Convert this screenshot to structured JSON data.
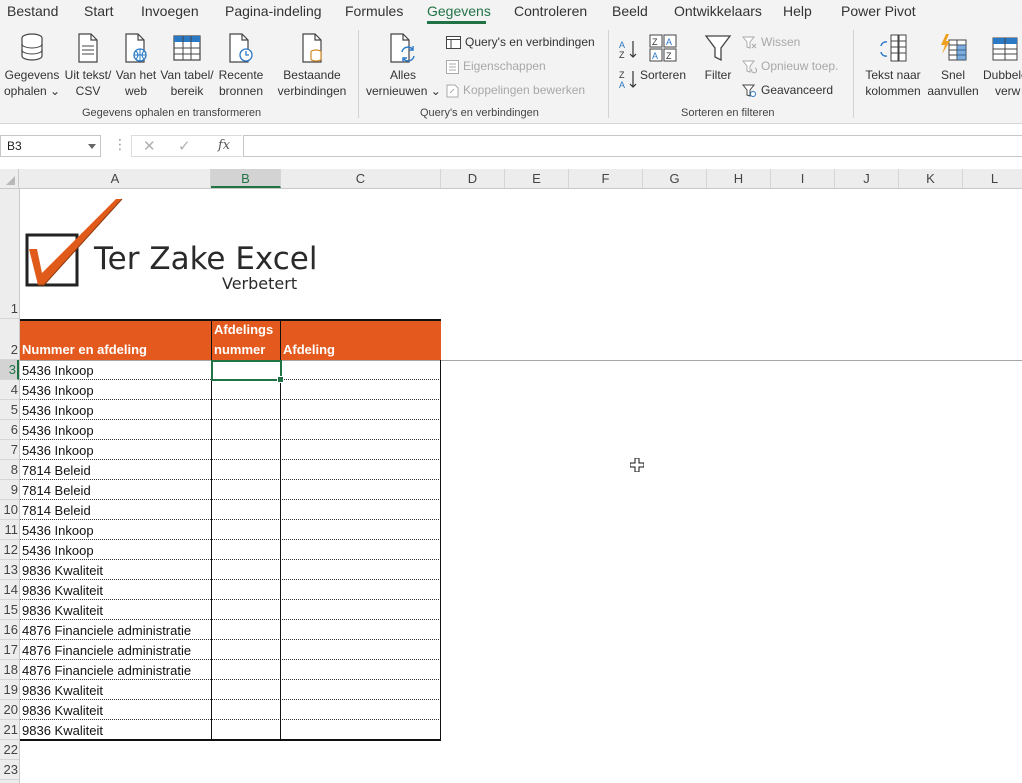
{
  "ribbon_tabs": [
    "Bestand",
    "Start",
    "Invoegen",
    "Pagina-indeling",
    "Formules",
    "Gegevens",
    "Controleren",
    "Beeld",
    "Ontwikkelaars",
    "Help",
    "Power Pivot"
  ],
  "active_tab": "Gegevens",
  "ribbon": {
    "get_data": {
      "line1": "Gegevens",
      "line2": "ophalen ⌄"
    },
    "from_text": {
      "line1": "Uit tekst/",
      "line2": "CSV"
    },
    "from_web": {
      "line1": "Van het",
      "line2": "web"
    },
    "from_table": {
      "line1": "Van tabel/",
      "line2": "bereik"
    },
    "recent_sources": {
      "line1": "Recente",
      "line2": "bronnen"
    },
    "existing_connections": {
      "line1": "Bestaande",
      "line2": "verbindingen"
    },
    "group_get_transform": "Gegevens ophalen en transformeren",
    "refresh_all": {
      "line1": "Alles",
      "line2": "vernieuwen ⌄"
    },
    "queries_connections": "Query's en verbindingen",
    "properties": "Eigenschappen",
    "edit_links": "Koppelingen bewerken",
    "group_queries": "Query's en verbindingen",
    "sort": "Sorteren",
    "filter": "Filter",
    "clear": "Wissen",
    "reapply": "Opnieuw toep.",
    "advanced": "Geavanceerd",
    "group_sort_filter": "Sorteren en filteren",
    "text_to_columns": {
      "line1": "Tekst naar",
      "line2": "kolommen"
    },
    "flash_fill": {
      "line1": "Snel",
      "line2": "aanvullen"
    },
    "remove_duplicates": {
      "line1": "Dubbele",
      "line2": "verw"
    }
  },
  "formula_bar": {
    "name_box": "B3",
    "cancel": "✕",
    "enter": "✓",
    "fx": "fx",
    "formula": ""
  },
  "columns": [
    "A",
    "B",
    "C",
    "D",
    "E",
    "F",
    "G",
    "H",
    "I",
    "J",
    "K",
    "L"
  ],
  "selected_column": "B",
  "rows": [
    "1",
    "2",
    "3",
    "4",
    "5",
    "6",
    "7",
    "8",
    "9",
    "10",
    "11",
    "12",
    "13",
    "14",
    "15",
    "16",
    "17",
    "18",
    "19",
    "20",
    "21",
    "22",
    "23"
  ],
  "selected_row": "3",
  "logo": {
    "title": "Ter Zake Excel",
    "subtitle": "Verbetert"
  },
  "table": {
    "headers": {
      "a": "Nummer en afdeling",
      "b_line1": "Afdelings",
      "b_line2": "nummer",
      "c": "Afdeling"
    },
    "values": [
      "5436 Inkoop",
      "5436 Inkoop",
      "5436 Inkoop",
      "5436 Inkoop",
      "5436 Inkoop",
      "7814 Beleid",
      "7814 Beleid",
      "7814 Beleid",
      "5436 Inkoop",
      "5436 Inkoop",
      "9836 Kwaliteit",
      "9836 Kwaliteit",
      "9836 Kwaliteit",
      "4876 Financiele administratie",
      "4876 Financiele administratie",
      "4876 Financiele administratie",
      "9836 Kwaliteit",
      "9836 Kwaliteit",
      "9836 Kwaliteit"
    ]
  },
  "colors": {
    "accent": "#217346",
    "header_fill": "#e45a1e",
    "logo_check": "#e05a1a"
  }
}
